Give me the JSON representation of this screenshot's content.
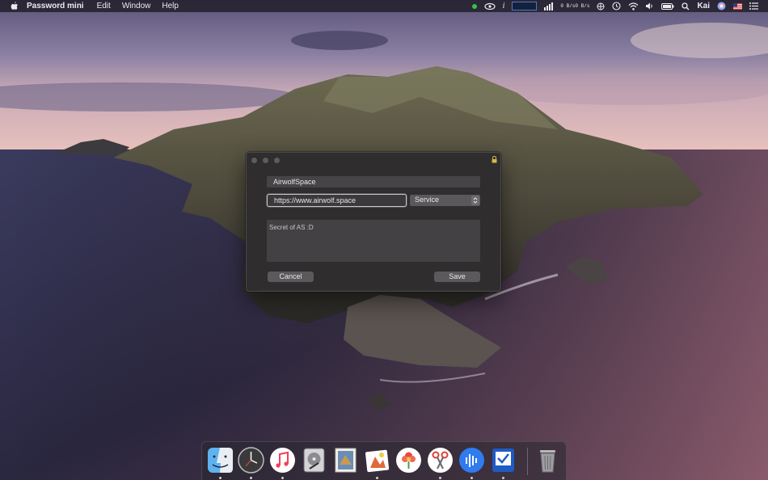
{
  "menubar": {
    "app_name": "Password mini",
    "menus": [
      "Edit",
      "Window",
      "Help"
    ],
    "net_up": "0 B/s",
    "net_down": "0 B/s",
    "user": "Kai",
    "info_glyph": "i"
  },
  "dialog": {
    "title_value": "AirwolfSpace",
    "url_value": "https://www.airwolf.space",
    "type_select": "Service",
    "notes_value": "Secret of AS :D",
    "cancel_label": "Cancel",
    "save_label": "Save"
  },
  "dock": {
    "apps": [
      "finder-icon",
      "clock-icon",
      "music-icon",
      "disk-utility-icon",
      "preview-stamp-icon",
      "photo-editor-icon",
      "photos-flower-icon",
      "scissors-icon",
      "audio-icon",
      "tasks-icon",
      "trash-icon"
    ]
  },
  "colors": {
    "menubar_bg": "#1c1a22",
    "dialog_bg": "#2f2d2e",
    "field_bg": "#464446",
    "button_bg": "#5b595b",
    "status_green": "#36c24a"
  }
}
